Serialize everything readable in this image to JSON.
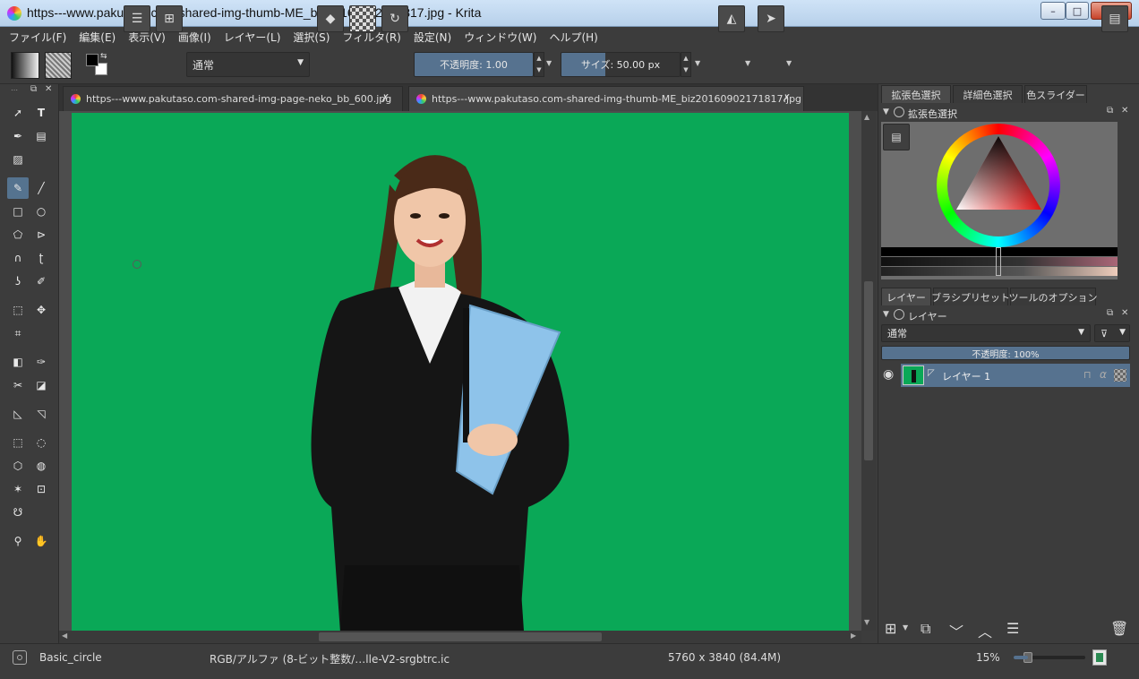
{
  "window": {
    "title": "https---www.pakutaso.com-shared-img-thumb-ME_biz20160902171817.jpg  - Krita",
    "minimize": "–",
    "maximize": "□",
    "close": "✕"
  },
  "menu": [
    "ファイル(F)",
    "編集(E)",
    "表示(V)",
    "画像(I)",
    "レイヤー(L)",
    "選択(S)",
    "フィルタ(R)",
    "設定(N)",
    "ウィンドウ(W)",
    "ヘルプ(H)"
  ],
  "toolbar": {
    "blend_mode": "通常",
    "opacity_label": "不透明度:  1.00",
    "opacity_fraction": 1.0,
    "size_label": "サイズ:  50.00 px",
    "size_fraction": 0.37
  },
  "doc_tabs": [
    {
      "label": "https---www.pakutaso.com-shared-img-page-neko_bb_600.jpg"
    },
    {
      "label": "https---www.pakutaso.com-shared-img-thumb-ME_biz20160902171817.jpg"
    }
  ],
  "dockers": {
    "top_tabs": [
      "拡張色選択",
      "詳細色選択",
      "色スライダー"
    ],
    "color_selector_title": "拡張色選択",
    "layer_tabs": [
      "レイヤー",
      "ブラシプリセット",
      "ツールのオプション"
    ],
    "layers_title": "レイヤー",
    "layer_blend_mode": "通常",
    "layer_opacity": "不透明度:  100%",
    "layer_name": "レイヤー 1"
  },
  "status": {
    "brush": "Basic_circle",
    "color_space": "RGB/アルファ (8-ビット整数/…lle-V2-srgbtrc.ic",
    "dimensions": "5760 x 3840 (84.4M)",
    "zoom": "15%",
    "zoom_fraction": 0.2
  },
  "colors": {
    "canvas_green": "#0aa857",
    "selection_blue": "#56728f",
    "panel": "#3c3c3c"
  }
}
